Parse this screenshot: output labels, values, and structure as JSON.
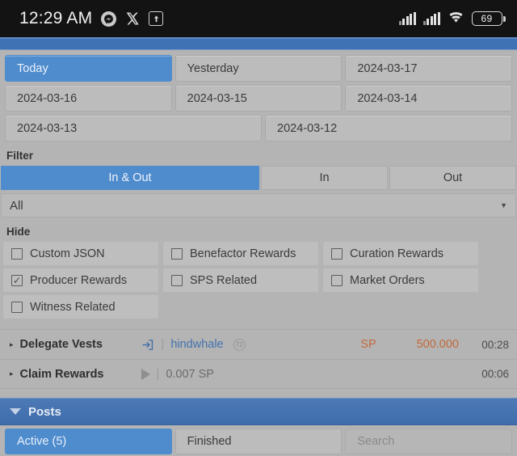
{
  "status_bar": {
    "clock": "12:29 AM",
    "icons": [
      "messenger-icon",
      "x-twitter-icon",
      "upload-icon"
    ],
    "signal_1": "signal-bars-icon",
    "signal_2": "signal-bars-icon",
    "wifi": "wifi-icon",
    "battery_level": "69"
  },
  "date_filter": {
    "rows": [
      [
        "Today",
        "Yesterday",
        "2024-03-17"
      ],
      [
        "2024-03-16",
        "2024-03-15",
        "2024-03-14"
      ],
      [
        "2024-03-13",
        "2024-03-12"
      ]
    ],
    "selected": "Today"
  },
  "filter": {
    "label": "Filter",
    "segments": [
      "In & Out",
      "In",
      "Out"
    ],
    "selected": "In & Out",
    "dropdown_value": "All",
    "dropdown_caret": "chevron-down-icon"
  },
  "hide": {
    "label": "Hide",
    "items": [
      {
        "label": "Custom JSON",
        "checked": false
      },
      {
        "label": "Benefactor Rewards",
        "checked": false
      },
      {
        "label": "Curation Rewards",
        "checked": false
      },
      {
        "label": "Producer Rewards",
        "checked": true
      },
      {
        "label": "SPS Related",
        "checked": false
      },
      {
        "label": "Market Orders",
        "checked": false
      },
      {
        "label": "Witness Related",
        "checked": false
      }
    ]
  },
  "transactions": [
    {
      "caret": "▸",
      "title": "Delegate Vests",
      "icon": "sign-in-arrow-icon",
      "separator": "|",
      "account": "hindwhale",
      "badge": "72",
      "unit": "SP",
      "amount": "500.000",
      "time": "00:28"
    },
    {
      "caret": "▸",
      "title": "Claim Rewards",
      "icon": "play-triangle-icon",
      "separator": "|",
      "detail": "0.007 SP",
      "unit": "",
      "amount": "",
      "time": "00:06"
    }
  ],
  "posts_panel": {
    "title": "Posts",
    "caret": "caret-down-icon",
    "tabs": [
      {
        "label": "Active (5)",
        "active": true
      },
      {
        "label": "Finished",
        "active": false
      }
    ],
    "search_placeholder": "Search"
  },
  "colors": {
    "accent_blue": "#4f8ccd",
    "panel_blue": "#3f6cab",
    "background_gray": "#b4b4b4",
    "amount_orange": "#c3693a",
    "link_blue": "#4372ad"
  }
}
